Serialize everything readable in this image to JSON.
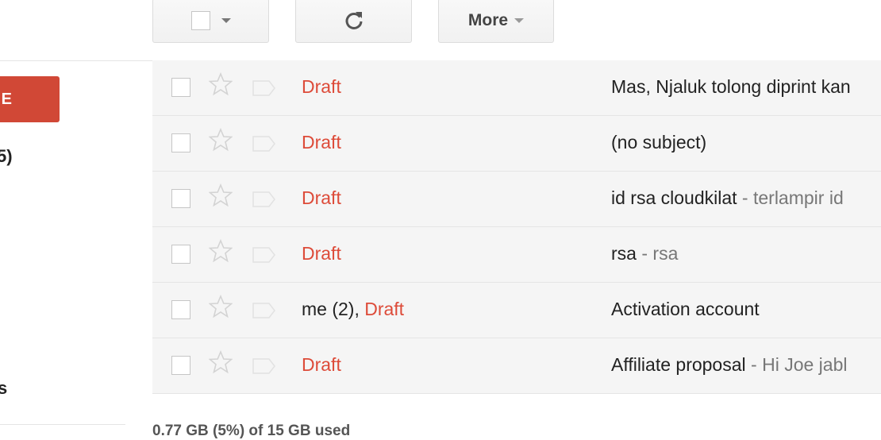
{
  "toolbar": {
    "more_label": "More"
  },
  "sidebar": {
    "compose_label": "E",
    "inbox_count_fragment": "5)",
    "fragment_text": "s"
  },
  "messages": [
    {
      "sender_prefix": "",
      "draft": "Draft",
      "subject": "Mas, Njaluk tolong diprint kan",
      "separator": "",
      "snippet": ""
    },
    {
      "sender_prefix": "",
      "draft": "Draft",
      "subject": "(no subject)",
      "separator": "",
      "snippet": ""
    },
    {
      "sender_prefix": "",
      "draft": "Draft",
      "subject": "id rsa cloudkilat",
      "separator": " - ",
      "snippet": "terlampir id"
    },
    {
      "sender_prefix": "",
      "draft": "Draft",
      "subject": "rsa",
      "separator": " - ",
      "snippet": "rsa"
    },
    {
      "sender_prefix": "me (2), ",
      "draft": "Draft",
      "subject": "Activation account",
      "separator": "",
      "snippet": ""
    },
    {
      "sender_prefix": "",
      "draft": "Draft",
      "subject": "Affiliate proposal",
      "separator": " - ",
      "snippet": "Hi Joe jabl"
    }
  ],
  "footer": {
    "storage_text": "0.77 GB (5%) of 15 GB used"
  },
  "colors": {
    "compose_red": "#d14836",
    "draft_red": "#dd4b39",
    "row_bg": "#f5f5f5"
  }
}
